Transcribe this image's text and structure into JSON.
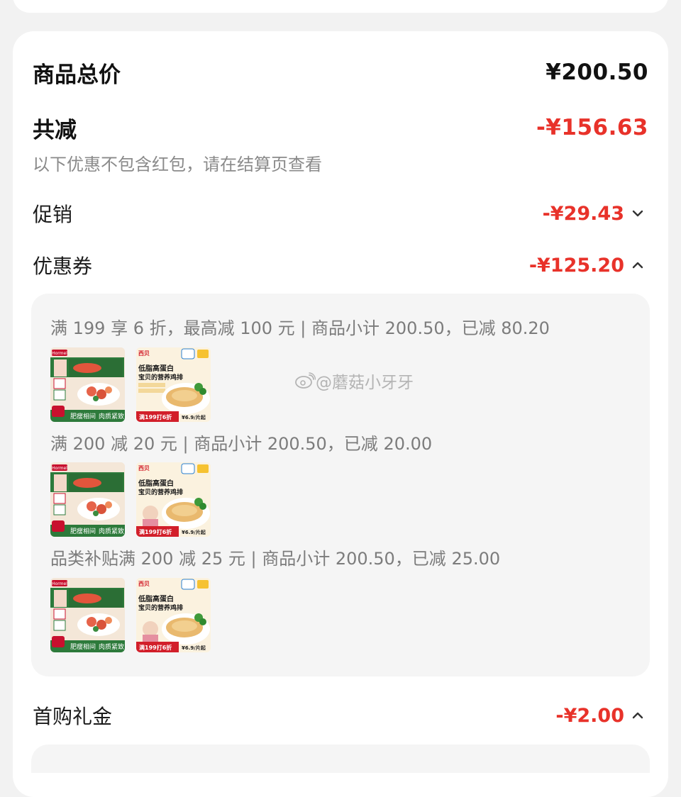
{
  "summary": {
    "total_label": "商品总价",
    "total_value": "¥200.50",
    "discount_label": "共减",
    "discount_value": "-¥156.63",
    "note": "以下优惠不包含红包，请在结算页查看"
  },
  "rows": {
    "promo_label": "促销",
    "promo_value": "-¥29.43",
    "coupon_label": "优惠券",
    "coupon_value": "-¥125.20",
    "first_gift_label": "首购礼金",
    "first_gift_value": "-¥2.00"
  },
  "coupons": [
    {
      "text": "满 199 享 6 折，最高减 100 元 | 商品小计 200.50，已减 80.20"
    },
    {
      "text": "满 200 减 20 元 | 商品小计 200.50，已减 20.00"
    },
    {
      "text": "品类补贴满 200 减 25 元 | 商品小计 200.50，已减 25.00"
    }
  ],
  "product_thumbs": {
    "a": {
      "brand": "Hormel",
      "line1": "肥瘦相间",
      "line2": "肉质紧致"
    },
    "b": {
      "brand": "西贝",
      "headline1": "低脂高蛋白",
      "headline2": "宝贝的营养鸡排",
      "tag": "满199打6折",
      "price": "¥6.9/片起"
    }
  },
  "watermark": "@蘑菇小牙牙",
  "icons": {
    "promo_chevron": "chevron-down-icon",
    "coupon_chevron": "chevron-up-icon",
    "gift_chevron": "chevron-up-icon",
    "watermark_logo": "weibo-logo-icon"
  },
  "colors": {
    "accent_red": "#e8322a",
    "card_bg": "#ffffff",
    "page_bg": "#f2f2f2",
    "coupon_bg": "#f5f5f5"
  }
}
